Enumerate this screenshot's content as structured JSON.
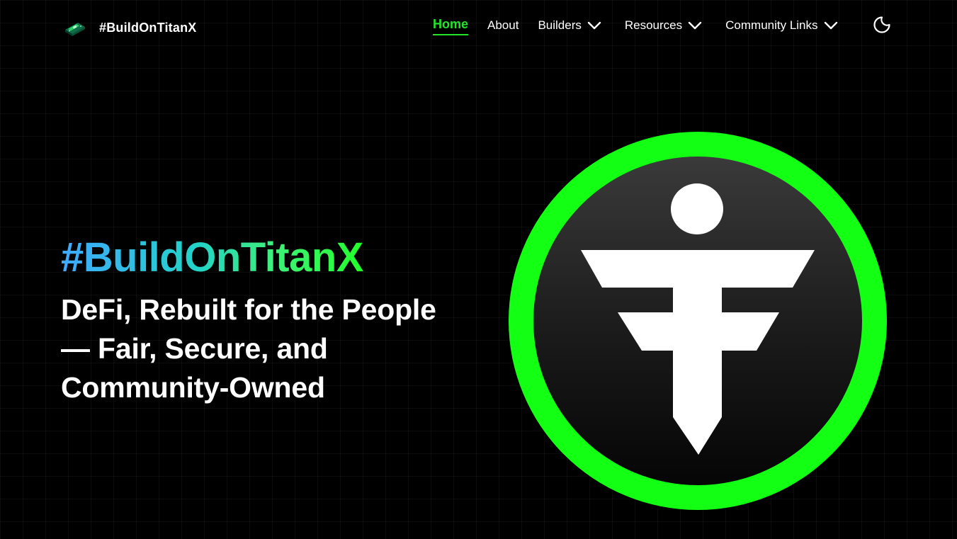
{
  "header": {
    "brand_name": "#BuildOnTitanX",
    "brand_logo_icon": "circuit-board-icon",
    "nav": {
      "home": "Home",
      "about": "About",
      "builders": "Builders",
      "resources": "Resources",
      "community": "Community Links"
    },
    "theme_toggle_icon": "moon-icon"
  },
  "hero": {
    "title": "#BuildOnTitanX",
    "subtitle": "DeFi, Rebuilt for the People — Fair, Secure, and Community-Owned",
    "logo_icon": "titanx-logo-icon"
  },
  "colors": {
    "background": "#000000",
    "accent_green": "#22e52a",
    "logo_ring": "#13ff13",
    "gradient_start": "#3fa9ff",
    "gradient_end": "#22ff2a"
  }
}
